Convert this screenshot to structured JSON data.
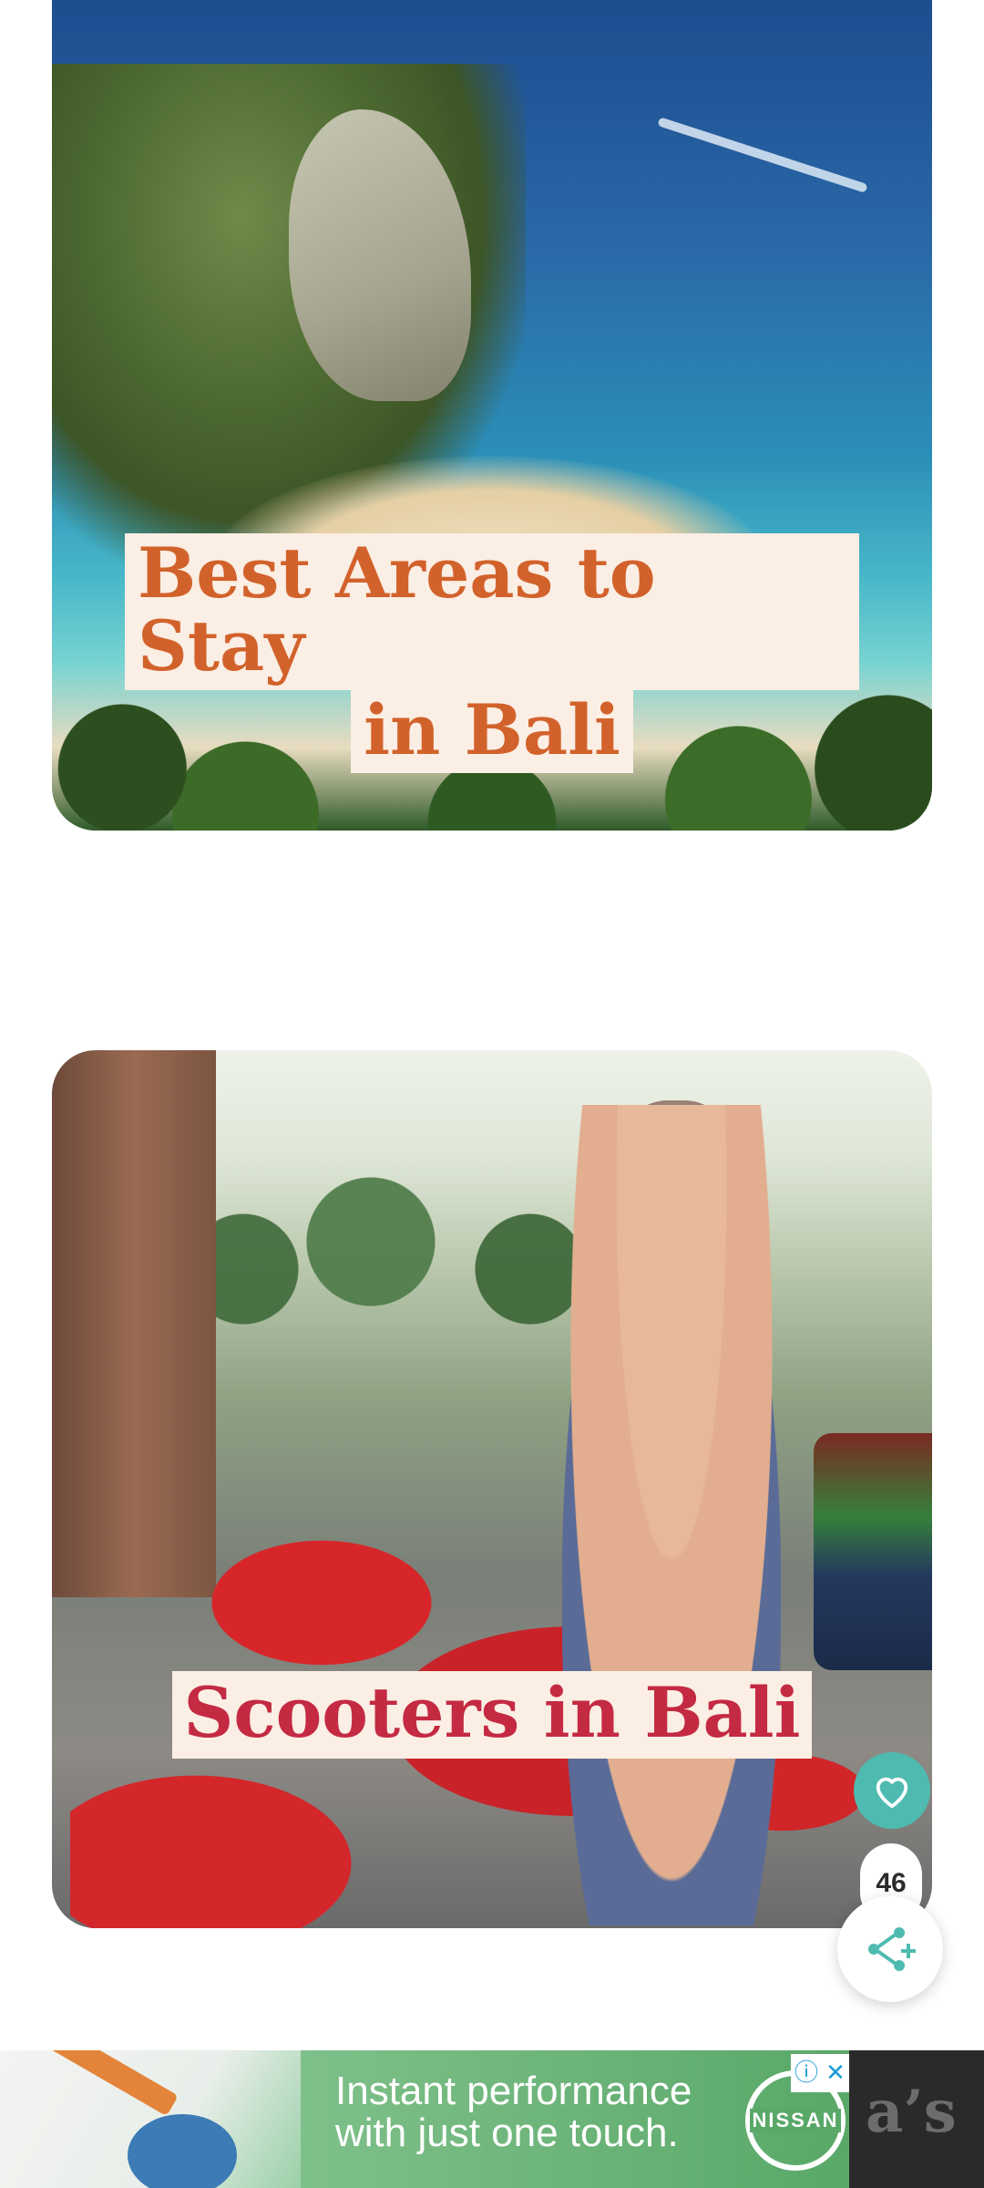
{
  "cards": [
    {
      "title_lines": [
        "Best Areas to Stay",
        "in Bali"
      ],
      "title_color": "#d2622b"
    },
    {
      "title_lines": [
        "Scooters in Bali"
      ],
      "title_color": "#c42a42"
    }
  ],
  "floating_actions": {
    "heart_icon": "heart-icon",
    "count": "46",
    "share_icon": "share-icon",
    "accent_color": "#4fbbb0"
  },
  "ad": {
    "line1": "Instant performance",
    "line2": "with just one touch.",
    "brand": "NISSAN",
    "partial_text": "a’s",
    "info_glyph": "ⓘ",
    "close_glyph": "✕"
  }
}
